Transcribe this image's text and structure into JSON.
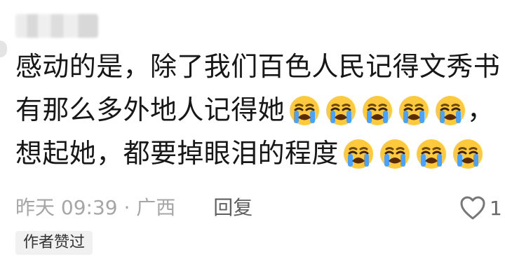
{
  "comment": {
    "author_blurred": "",
    "lines": [
      "感动的是，除了我们百色人民记得文秀书",
      "有那么多外地人记得她",
      "想起她，都要掉眼泪的程度"
    ],
    "line2_emoji": "crying-face-emoji",
    "line3_emoji": "crying-face-emoji"
  },
  "meta": {
    "time_location": "昨天 09:39 · 广西",
    "reply_label": "回复",
    "like_count": "1"
  },
  "badge": {
    "label": "作者赞过"
  },
  "colors": {
    "text": "#171717",
    "meta": "#a6a6a6",
    "badge_bg": "#f1f1f1",
    "emoji_yellow": "#ffc93d",
    "emoji_tear": "#4aa2ff"
  }
}
